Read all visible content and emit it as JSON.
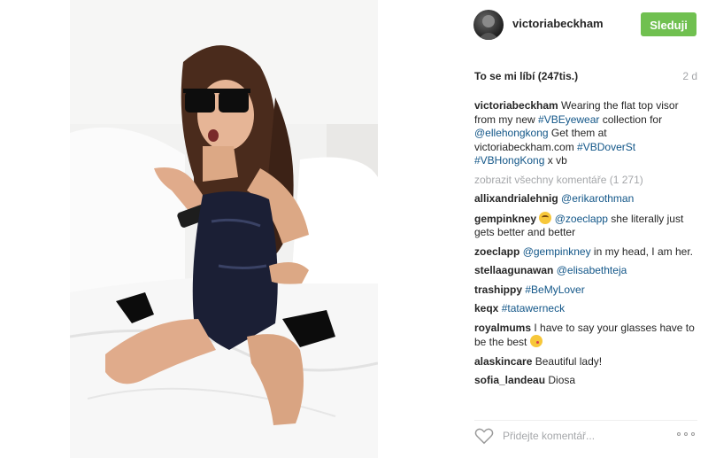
{
  "post": {
    "username": "victoriabeckham",
    "follow_label": "Sleduji",
    "likes": "To se mi líbí (247tis.)",
    "date": "2 d"
  },
  "caption": {
    "user": "victoriabeckham",
    "text1": " Wearing the flat top visor from my new ",
    "tag1": "#VBEyewear",
    "text2": " collection for ",
    "tag2": "@ellehongkong",
    "text3": " Get them at victoriabeckham.com ",
    "tag3": "#VBDoverSt",
    "tag4": "#VBHongKong",
    "text4": " x vb"
  },
  "view_all_comments": "zobrazit všechny komentáře (1 271)",
  "comments": [
    {
      "user": "allixandrialehnig",
      "mention": "@erikarothman",
      "text": ""
    },
    {
      "user": "gempinkney",
      "mention": "@zoeclapp",
      "text": " she literally just gets better and better"
    },
    {
      "user": "zoeclapp",
      "mention": "@gempinkney",
      "text": " in my head, I am her."
    },
    {
      "user": "stellaagunawan",
      "mention": "@elisabethteja",
      "text": ""
    },
    {
      "user": "trashippy",
      "mention": "#BeMyLover",
      "text": ""
    },
    {
      "user": "keqx",
      "mention": "#tatawerneck",
      "text": ""
    },
    {
      "user": "royalmums",
      "mention": "",
      "text": "I have to say your glasses have to be the best"
    },
    {
      "user": "alaskincare",
      "mention": "",
      "text": "Beautiful lady!"
    },
    {
      "user": "sofia_landeau",
      "mention": "",
      "text": "Diosa"
    }
  ],
  "input": {
    "placeholder": "Přidejte komentář..."
  },
  "colors": {
    "follow_green": "#70c050",
    "link_blue": "#125688",
    "muted_gray": "#a5a7aa"
  },
  "icons": [
    "heart-icon",
    "more-options-icon",
    "avatar",
    "grinning-emoji-icon",
    "kiss-emoji-icon"
  ]
}
